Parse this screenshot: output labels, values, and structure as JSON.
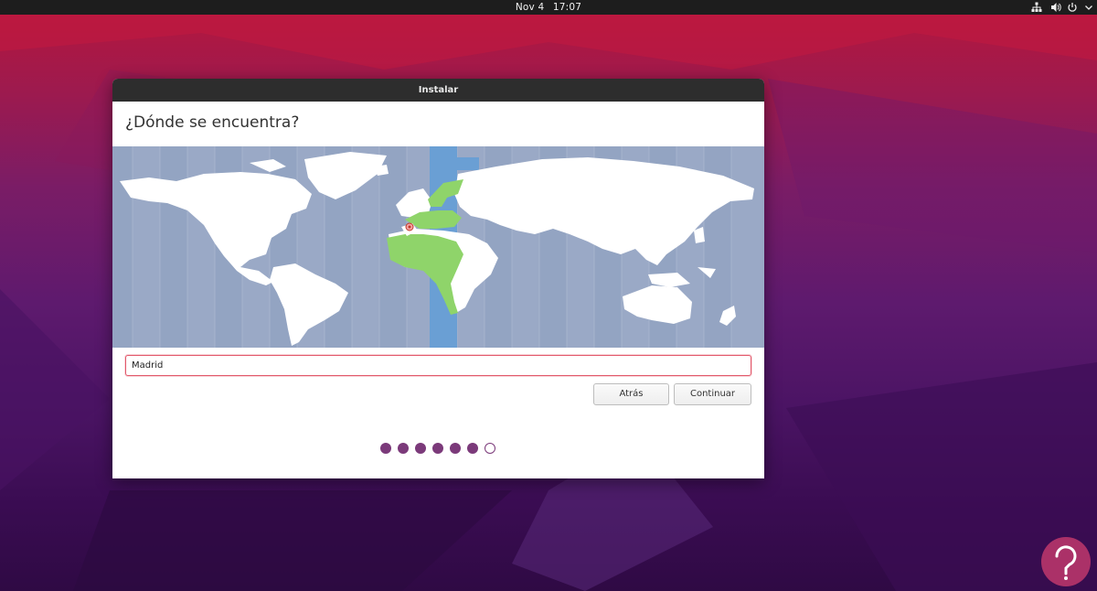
{
  "topbar": {
    "date": "Nov 4",
    "time": "17:07",
    "icons": [
      "network-icon",
      "volume-icon",
      "power-icon",
      "menu-arrow-icon"
    ]
  },
  "window": {
    "title": "Instalar",
    "heading": "¿Dónde se encuentra?",
    "map": {
      "selected_timezone_color": "#6a9fd4",
      "highlight_color": "#8fd46a",
      "ocean_color": "#9aa9c6",
      "land_color": "#ffffff"
    },
    "location_input": {
      "value": "Madrid"
    },
    "buttons": {
      "back": "Atrás",
      "continue": "Continuar"
    },
    "progress": {
      "total_steps": 7,
      "completed_steps": 6
    }
  },
  "colors": {
    "accent": "#7b3a7a",
    "input_focus": "#e2596b"
  }
}
